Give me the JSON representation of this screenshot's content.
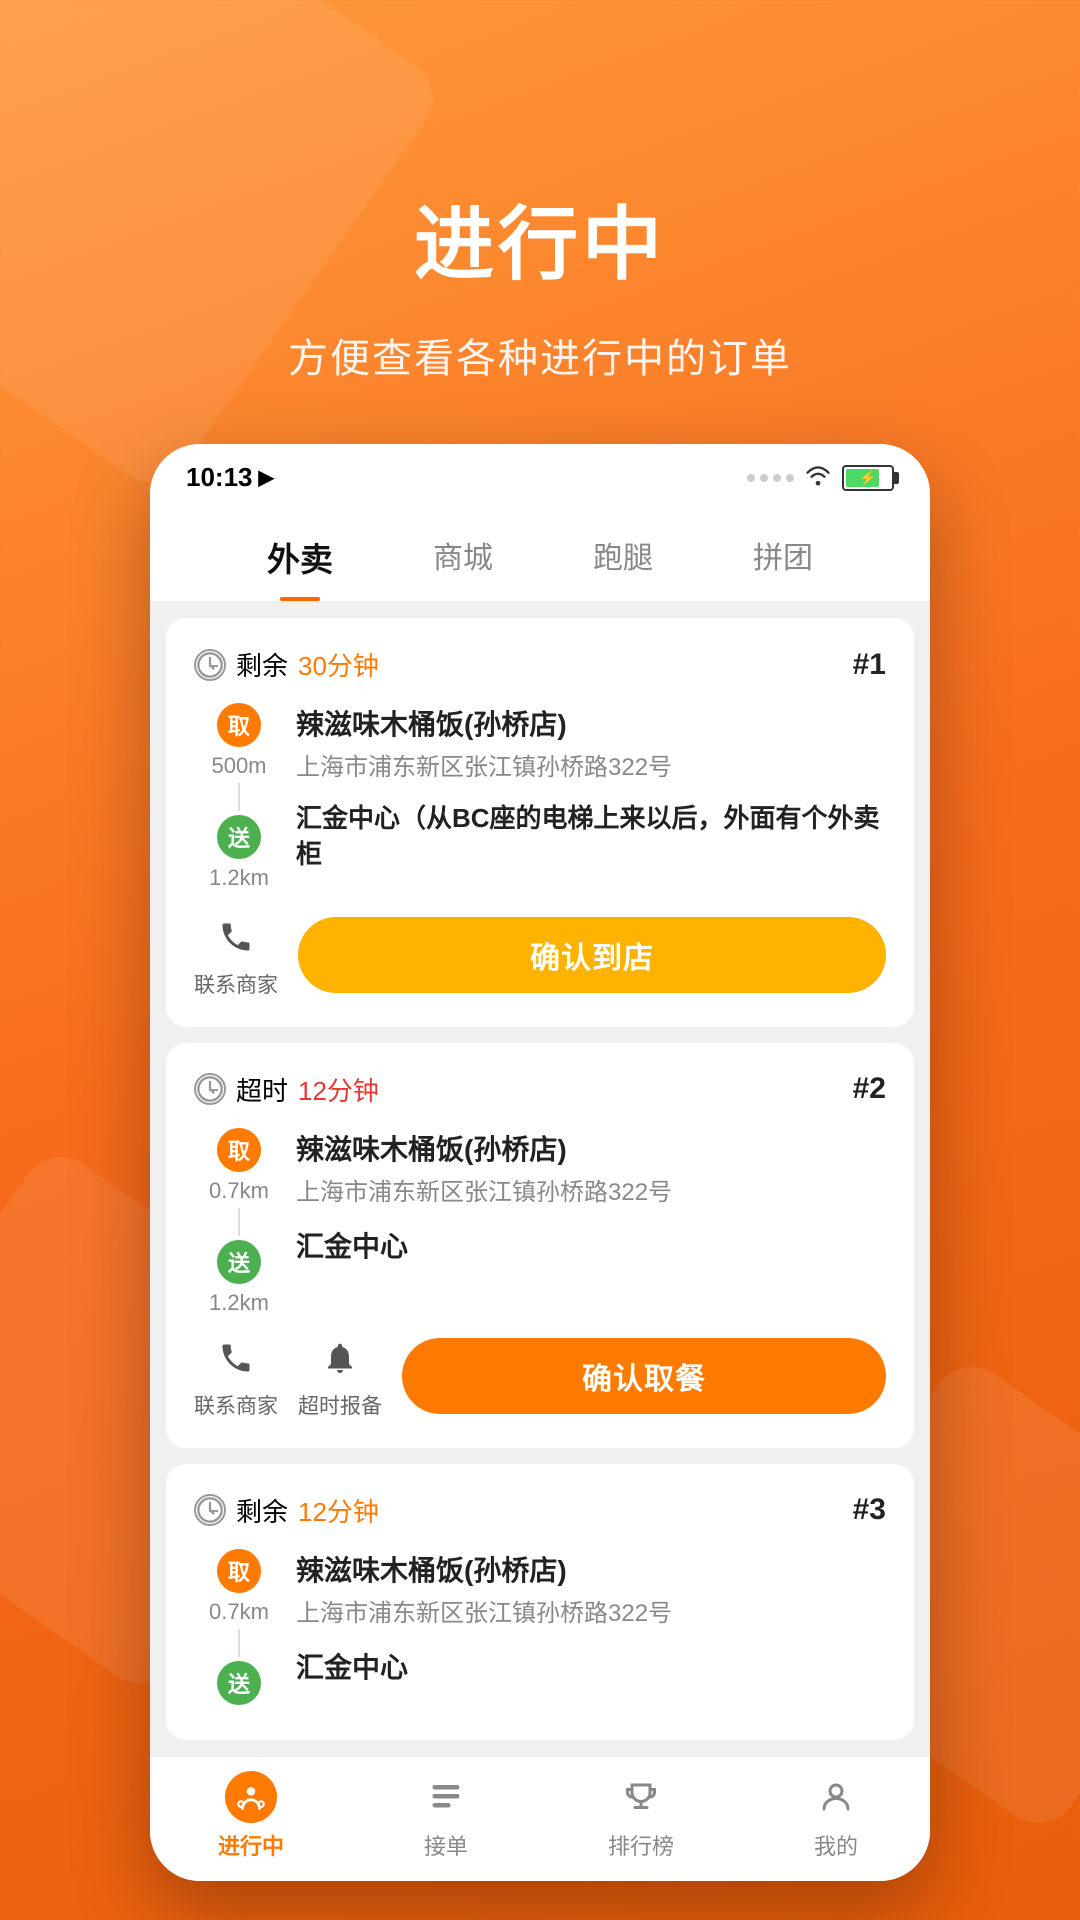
{
  "app": {
    "bg_gradient_start": "#FF9A3C",
    "bg_gradient_end": "#E85D0A"
  },
  "header": {
    "title": "进行中",
    "subtitle": "方便查看各种进行中的订单"
  },
  "status_bar": {
    "time": "10:13",
    "nav_arrow": "▶"
  },
  "nav_tabs": [
    {
      "label": "外卖",
      "active": true
    },
    {
      "label": "商城",
      "active": false
    },
    {
      "label": "跑腿",
      "active": false
    },
    {
      "label": "拼团",
      "active": false
    }
  ],
  "orders": [
    {
      "id": 1,
      "number": "#1",
      "time_label": "剩余",
      "time_value": "30分钟",
      "time_type": "remaining",
      "pickup": {
        "badge": "取",
        "distance": "500m",
        "name": "辣滋味木桶饭(孙桥店)",
        "address": "上海市浦东新区张江镇孙桥路322号"
      },
      "deliver": {
        "badge": "送",
        "distance": "1.2km",
        "name": "汇金中心（从BC座的电梯上来以后，外面有个外卖柜",
        "address": ""
      },
      "actions": [
        {
          "icon": "phone",
          "label": "联系商家"
        }
      ],
      "confirm_btn": {
        "label": "确认到店",
        "style": "yellow"
      }
    },
    {
      "id": 2,
      "number": "#2",
      "time_label": "超时",
      "time_value": "12分钟",
      "time_type": "overdue",
      "pickup": {
        "badge": "取",
        "distance": "0.7km",
        "name": "辣滋味木桶饭(孙桥店)",
        "address": "上海市浦东新区张江镇孙桥路322号"
      },
      "deliver": {
        "badge": "送",
        "distance": "1.2km",
        "name": "汇金中心",
        "address": ""
      },
      "actions": [
        {
          "icon": "phone",
          "label": "联系商家"
        },
        {
          "icon": "bell",
          "label": "超时报备"
        }
      ],
      "confirm_btn": {
        "label": "确认取餐",
        "style": "orange"
      }
    },
    {
      "id": 3,
      "number": "#3",
      "time_label": "剩余",
      "time_value": "12分钟",
      "time_type": "remaining",
      "pickup": {
        "badge": "取",
        "distance": "0.7km",
        "name": "辣滋味木桶饭(孙桥店)",
        "address": "上海市浦东新区张江镇孙桥路322号"
      },
      "deliver": {
        "badge": "送",
        "distance": "",
        "name": "汇金中心",
        "address": ""
      },
      "actions": [],
      "confirm_btn": null
    }
  ],
  "bottom_nav": [
    {
      "icon": "rider",
      "label": "进行中",
      "active": true
    },
    {
      "icon": "list",
      "label": "接单",
      "active": false
    },
    {
      "icon": "trophy",
      "label": "排行榜",
      "active": false
    },
    {
      "icon": "user",
      "label": "我的",
      "active": false
    }
  ]
}
